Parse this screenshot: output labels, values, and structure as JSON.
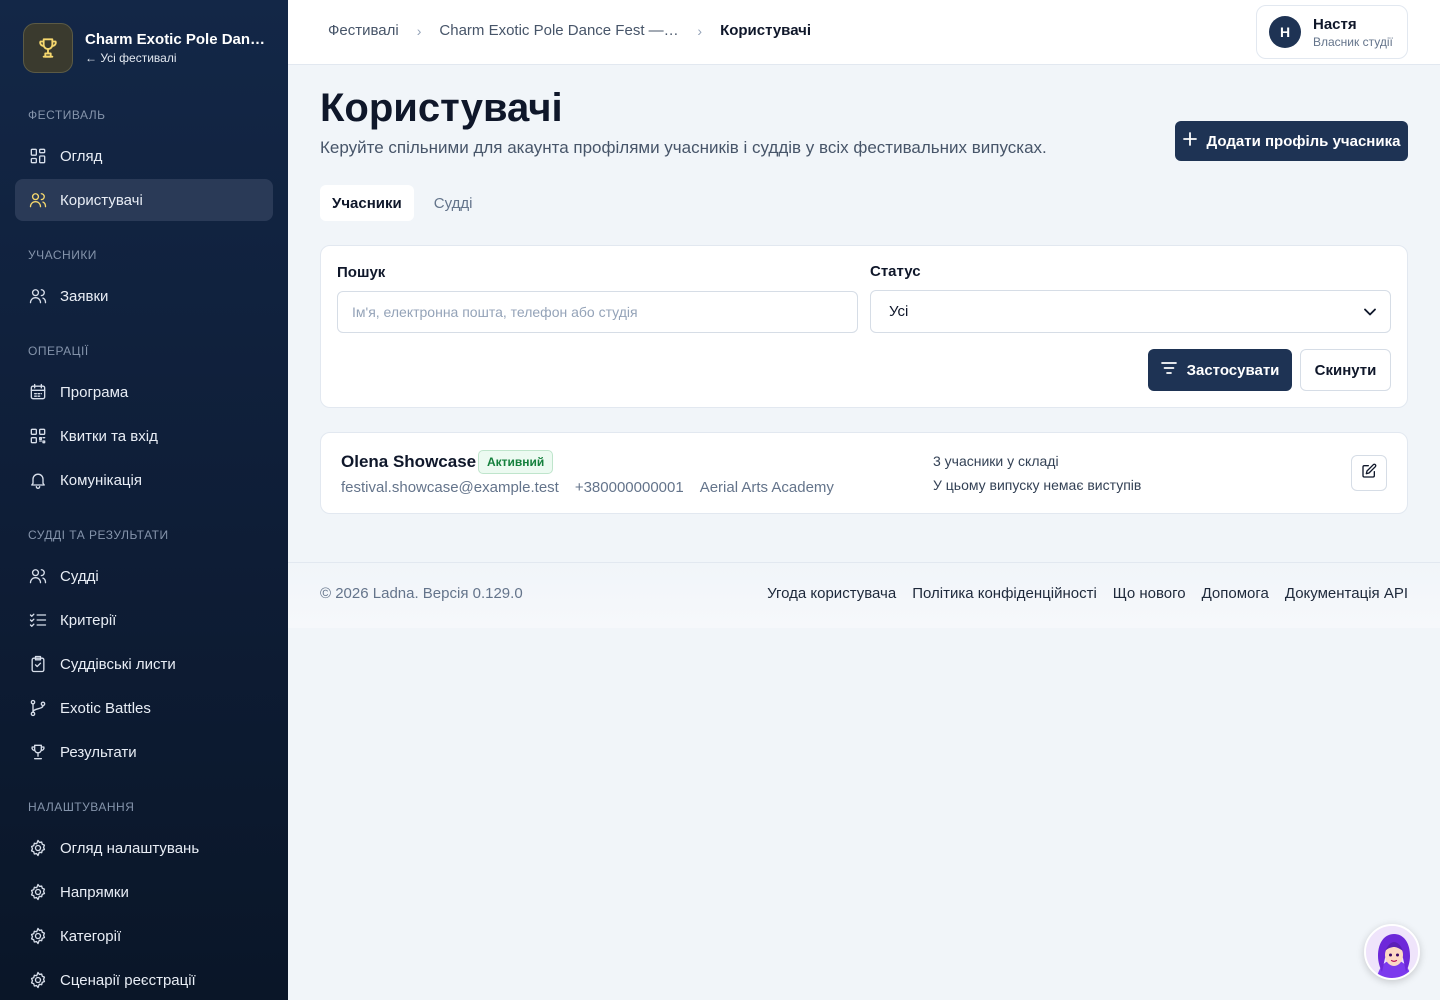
{
  "sidebar": {
    "brand_title": "Charm Exotic Pole Dance Fest — All Stars",
    "back_link": "← Усі фестивалі",
    "sections": {
      "festival": "Фестиваль",
      "participants": "Учасники",
      "operations": "Операції",
      "judges_results": "Судді та результати",
      "settings": "Налаштування"
    },
    "items": {
      "overview": "Огляд",
      "users": "Користувачі",
      "applications": "Заявки",
      "program": "Програма",
      "tickets": "Квитки та вхід",
      "communication": "Комунікація",
      "judges": "Судді",
      "criteria": "Критерії",
      "score_sheets": "Суддівські листи",
      "battles": "Exotic Battles",
      "results": "Результати",
      "settings_overview": "Огляд налаштувань",
      "directions": "Напрямки",
      "categories": "Категорії",
      "registration_scenarios": "Сценарії реєстрації"
    }
  },
  "breadcrumb": {
    "festivals": "Фестивалі",
    "festival": "Charm Exotic Pole Dance Fest — All Stars",
    "current": "Користувачі"
  },
  "user": {
    "initial": "Н",
    "name": "Настя",
    "role": "Власник студії"
  },
  "page": {
    "title": "Користувачі",
    "subtitle": "Керуйте спільними для акаунта профілями учасників і суддів у всіх фестивальних випусках.",
    "add_button": "Додати профіль учасника"
  },
  "tabs": [
    "Учасники",
    "Судді"
  ],
  "filters": {
    "search_label": "Пошук",
    "search_placeholder": "Ім'я, електронна пошта, телефон або студія",
    "search_value": "",
    "status_label": "Статус",
    "status_value": "Усі",
    "apply": "Застосувати",
    "reset": "Скинути"
  },
  "participants": [
    {
      "name": "Olena Showcase",
      "status": "Активний",
      "email": "festival.showcase@example.test",
      "phone": "+380000000001",
      "studio": "Aerial Arts Academy",
      "members": "3 учасники у складі",
      "performances": "У цьому випуску немає виступів"
    }
  ],
  "footer": {
    "copyright": "© 2026 Ladna. Версія 0.129.0",
    "links": [
      "Угода користувача",
      "Політика конфіденційності",
      "Що нового",
      "Допомога",
      "Документація API"
    ]
  },
  "icons": {
    "brand": "trophy-icon",
    "assistant": "assistant-avatar-icon"
  },
  "colors": {
    "sidebar_bg": "#132747",
    "primary": "#1e3354",
    "badge_text": "#15803d"
  }
}
